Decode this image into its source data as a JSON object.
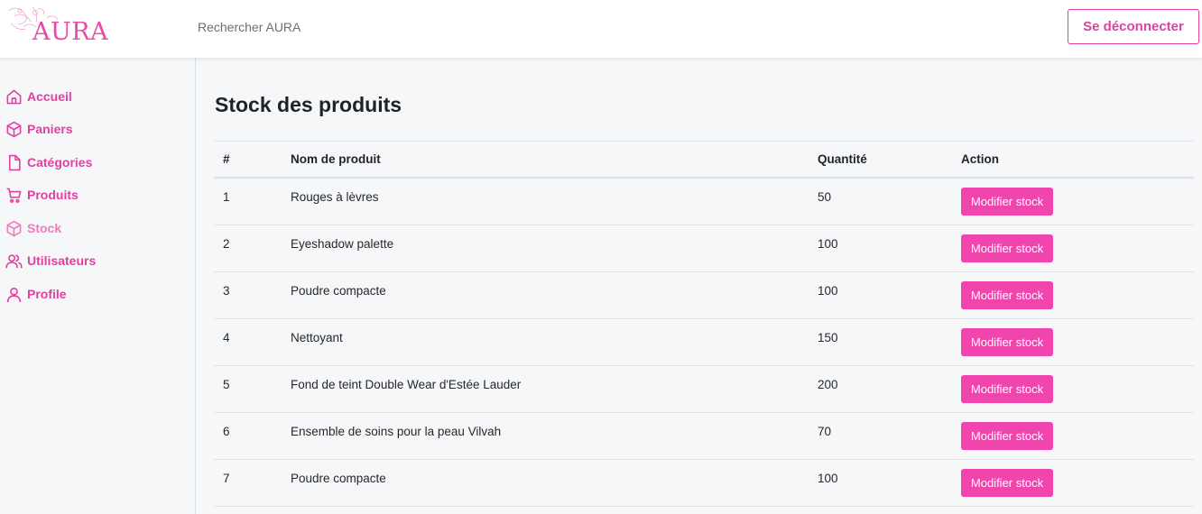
{
  "header": {
    "logo_text": "AURA",
    "search_placeholder": "Rechercher AURA",
    "logout_label": "Se déconnecter"
  },
  "colors": {
    "accent": "#e0409f",
    "button": "#ef45ad",
    "active_nav": "#f279bd"
  },
  "sidebar": {
    "items": [
      {
        "label": "Accueil",
        "icon": "home-icon"
      },
      {
        "label": "Paniers",
        "icon": "box-icon"
      },
      {
        "label": "Catégories",
        "icon": "file-icon"
      },
      {
        "label": "Produits",
        "icon": "cart-icon"
      },
      {
        "label": "Stock",
        "icon": "box-icon",
        "active": true
      },
      {
        "label": "Utilisateurs",
        "icon": "users-icon"
      },
      {
        "label": "Profile",
        "icon": "user-icon"
      }
    ]
  },
  "main": {
    "title": "Stock des produits",
    "table": {
      "headers": [
        "#",
        "Nom de produit",
        "Quantité",
        "Action"
      ],
      "action_label": "Modifier stock",
      "rows": [
        {
          "id": "1",
          "name": "Rouges à lèvres",
          "qty": "50"
        },
        {
          "id": "2",
          "name": "Eyeshadow palette",
          "qty": "100"
        },
        {
          "id": "3",
          "name": "Poudre compacte",
          "qty": "100"
        },
        {
          "id": "4",
          "name": "Nettoyant",
          "qty": "150"
        },
        {
          "id": "5",
          "name": "Fond de teint Double Wear d'Estée Lauder",
          "qty": "200"
        },
        {
          "id": "6",
          "name": "Ensemble de soins pour la peau Vilvah",
          "qty": "70"
        },
        {
          "id": "7",
          "name": "Poudre compacte",
          "qty": "100"
        }
      ]
    }
  }
}
